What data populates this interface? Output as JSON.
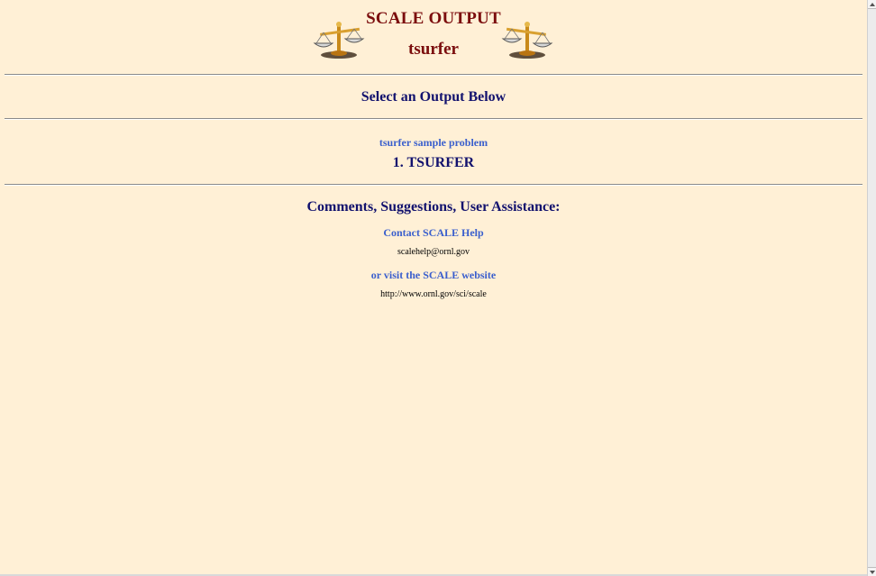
{
  "header": {
    "title": "SCALE OUTPUT",
    "subtitle": "tsurfer",
    "logo_icon": "scales-of-justice-icon"
  },
  "section": {
    "heading": "Select an Output Below"
  },
  "outputs": {
    "sample_link": "tsurfer sample problem",
    "items": [
      {
        "label": "1. TSURFER"
      }
    ]
  },
  "support": {
    "heading": "Comments, Suggestions, User Assistance:",
    "contact_link": "Contact SCALE Help",
    "email": "scalehelp@ornl.gov",
    "website_link": "or visit the SCALE website",
    "url": "http://www.ornl.gov/sci/scale"
  },
  "colors": {
    "background": "#fff0d6",
    "title": "#7b0d0d",
    "heading": "#12126e",
    "link": "#3a5fcd"
  }
}
